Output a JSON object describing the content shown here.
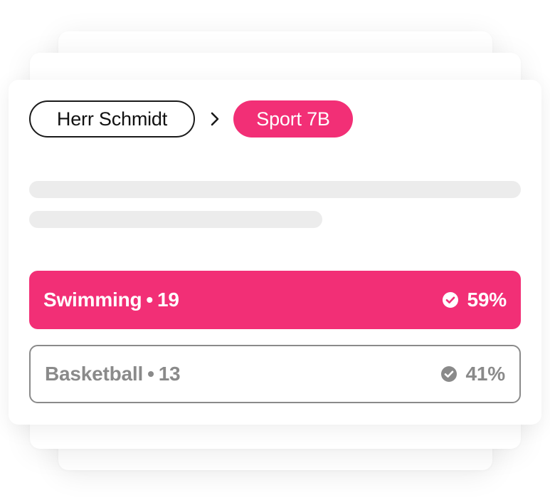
{
  "breadcrumb": {
    "teacher": "Herr Schmidt",
    "class": "Sport 7B"
  },
  "poll": {
    "options": [
      {
        "label": "Swimming",
        "separator": "•",
        "count": "19",
        "percent": "59%",
        "share": 0.59
      },
      {
        "label": "Basketball",
        "separator": "•",
        "count": "13",
        "percent": "41%",
        "share": 0.41
      }
    ]
  },
  "colors": {
    "accent": "#f22f76",
    "muted": "#8a8a8a",
    "skeleton": "#ececec"
  },
  "icons": {
    "breadcrumb_separator": "chevron-right-icon",
    "vote_check": "check-circle-icon"
  }
}
